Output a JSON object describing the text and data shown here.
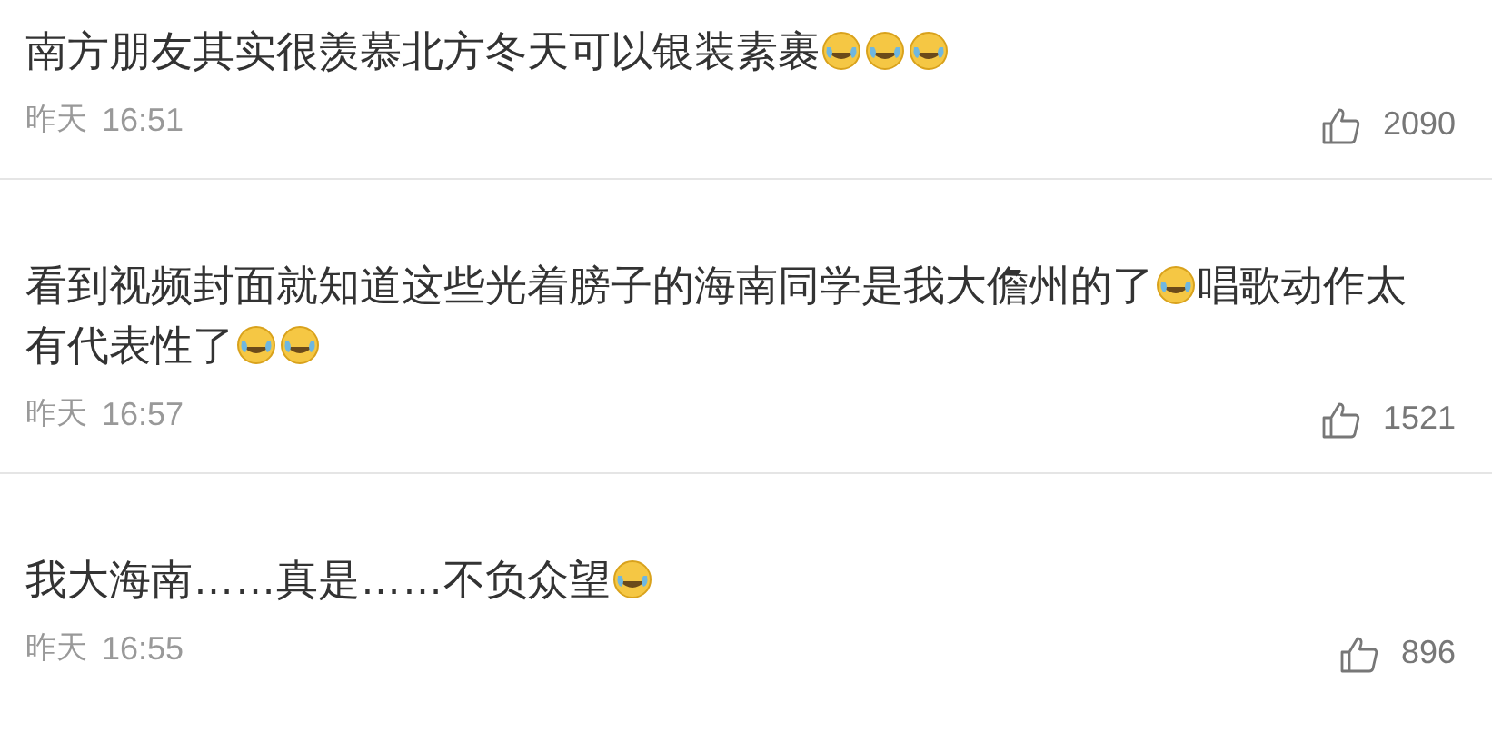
{
  "comments": [
    {
      "parts": [
        {
          "kind": "text",
          "text": "南方朋友其实很羡慕北方冬天可以银装素裹"
        },
        {
          "kind": "emoji"
        },
        {
          "kind": "emoji"
        },
        {
          "kind": "emoji"
        }
      ],
      "day": "昨天",
      "time": "16:51",
      "likes": "2090"
    },
    {
      "parts": [
        {
          "kind": "text",
          "text": "看到视频封面就知道这些光着膀子的海南同学是我大儋州的了"
        },
        {
          "kind": "emoji"
        },
        {
          "kind": "text",
          "text": "唱歌动作太有代表性了"
        },
        {
          "kind": "emoji"
        },
        {
          "kind": "emoji"
        }
      ],
      "day": "昨天",
      "time": "16:57",
      "likes": "1521"
    },
    {
      "parts": [
        {
          "kind": "text",
          "text": "我大海南……真是……不负众望"
        },
        {
          "kind": "emoji"
        }
      ],
      "day": "昨天",
      "time": "16:55",
      "likes": "896"
    }
  ]
}
